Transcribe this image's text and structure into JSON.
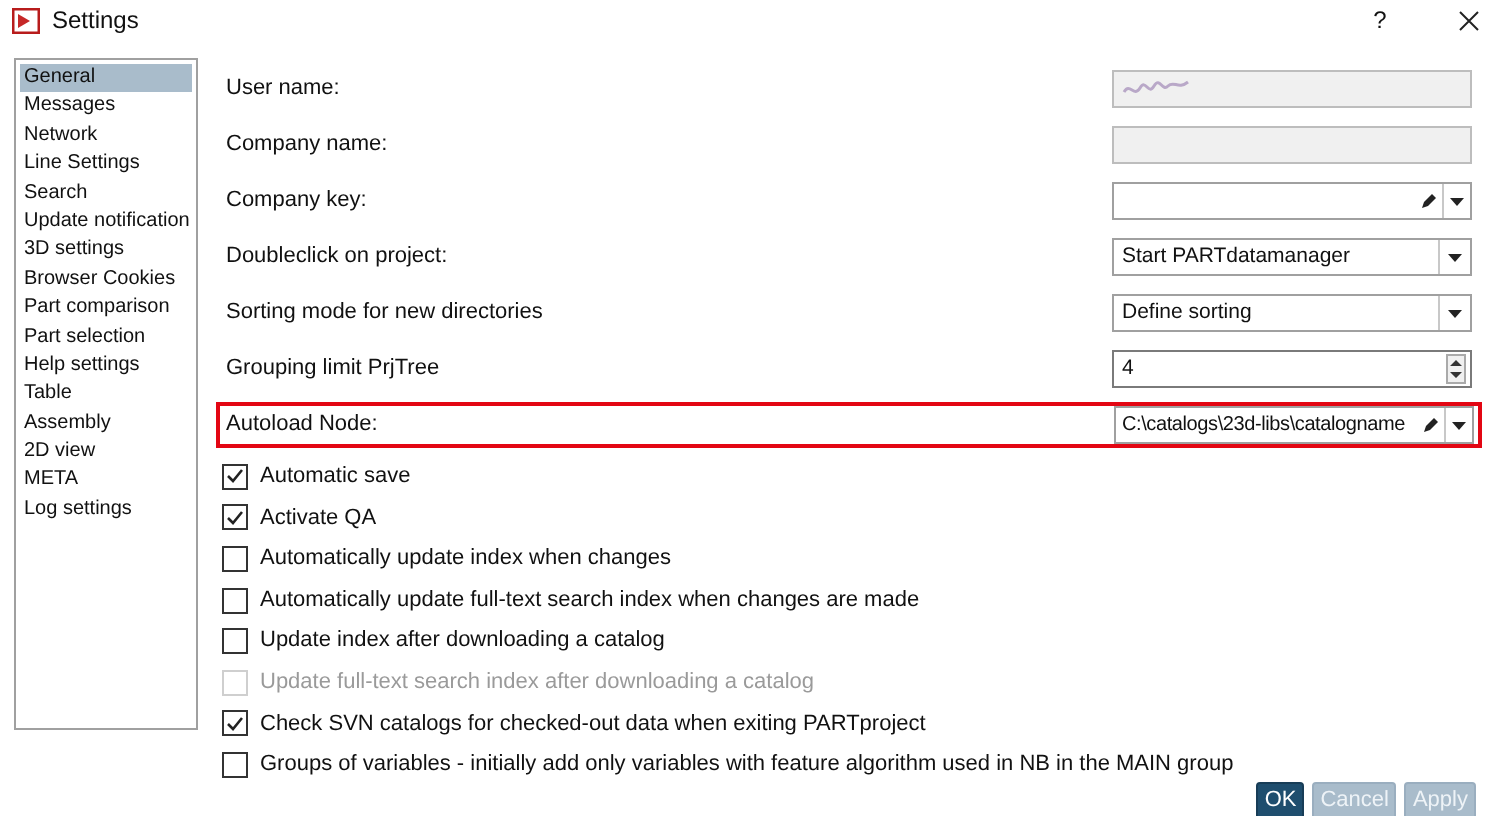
{
  "window": {
    "title": "Settings",
    "help": "?"
  },
  "sidebar": {
    "items": [
      {
        "label": "General",
        "selected": true
      },
      {
        "label": "Messages",
        "selected": false
      },
      {
        "label": "Network",
        "selected": false
      },
      {
        "label": "Line Settings",
        "selected": false
      },
      {
        "label": "Search",
        "selected": false
      },
      {
        "label": "Update notification",
        "selected": false
      },
      {
        "label": "3D settings",
        "selected": false
      },
      {
        "label": "Browser Cookies",
        "selected": false
      },
      {
        "label": "Part comparison",
        "selected": false
      },
      {
        "label": "Part selection",
        "selected": false
      },
      {
        "label": "Help settings",
        "selected": false
      },
      {
        "label": "Table",
        "selected": false
      },
      {
        "label": "Assembly",
        "selected": false
      },
      {
        "label": "2D view",
        "selected": false
      },
      {
        "label": "META",
        "selected": false
      },
      {
        "label": "Log settings",
        "selected": false
      }
    ]
  },
  "fields": [
    {
      "label": "User name:",
      "kind": "readonly",
      "blurred": true,
      "highlighted": false
    },
    {
      "label": "Company name:",
      "kind": "readonly",
      "blurred": false,
      "highlighted": false
    },
    {
      "label": "Company key:",
      "kind": "editcombo",
      "highlighted": false
    },
    {
      "label": "Doubleclick on project:",
      "kind": "combo",
      "value": "Start PARTdatamanager",
      "highlighted": false
    },
    {
      "label": "Sorting mode for new directories",
      "kind": "combo",
      "value": "Define sorting",
      "highlighted": false
    },
    {
      "label": "Grouping limit PrjTree",
      "kind": "spin",
      "value": "4",
      "highlighted": false
    },
    {
      "label": "Autoload Node:",
      "kind": "editcombo",
      "value": "C:\\catalogs\\23d-libs\\catalogname",
      "highlighted": true
    }
  ],
  "options": [
    {
      "label": "Automatic save",
      "checked": true,
      "disabled": false
    },
    {
      "label": "Activate QA",
      "checked": true,
      "disabled": false
    },
    {
      "label": "Automatically update index when changes",
      "checked": false,
      "disabled": false
    },
    {
      "label": "Automatically update full-text search index when changes are made",
      "checked": false,
      "disabled": false
    },
    {
      "label": "Update index after downloading a catalog",
      "checked": false,
      "disabled": false
    },
    {
      "label": "Update full-text search index after downloading a catalog",
      "checked": false,
      "disabled": true
    },
    {
      "label": "Check SVN catalogs for checked-out data when exiting PARTproject",
      "checked": true,
      "disabled": false
    },
    {
      "label": "Groups of variables - initially add only variables with feature algorithm used in NB in the MAIN group",
      "checked": false,
      "disabled": false
    }
  ],
  "buttons": [
    {
      "label": "OK",
      "disabled": false
    },
    {
      "label": "Cancel",
      "disabled": true
    },
    {
      "label": "Apply",
      "disabled": true
    }
  ]
}
